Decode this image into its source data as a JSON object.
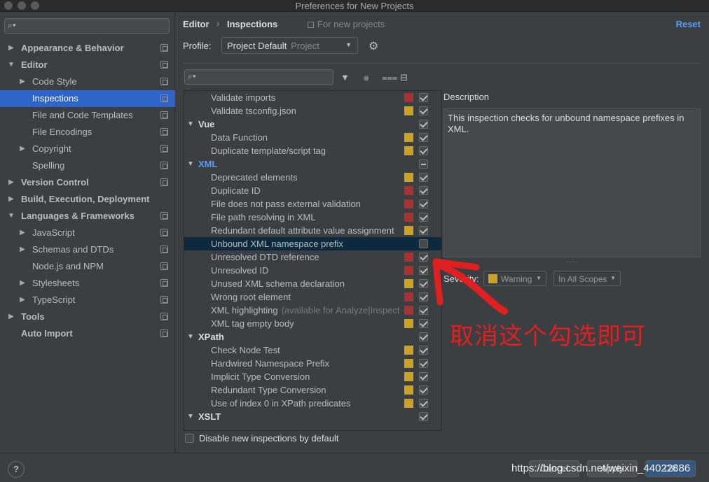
{
  "window": {
    "title": "Preferences for New Projects"
  },
  "sidebar": {
    "search_placeholder": "",
    "items": [
      {
        "label": "Appearance & Behavior",
        "bold": true,
        "level": 0,
        "arrow": "▶",
        "copy": true
      },
      {
        "label": "Editor",
        "bold": true,
        "level": 0,
        "arrow": "▼",
        "copy": true
      },
      {
        "label": "Code Style",
        "bold": false,
        "level": 1,
        "arrow": "▶",
        "copy": true
      },
      {
        "label": "Inspections",
        "bold": false,
        "level": 1,
        "arrow": "",
        "copy": true,
        "selected": true
      },
      {
        "label": "File and Code Templates",
        "bold": false,
        "level": 1,
        "arrow": "",
        "copy": true
      },
      {
        "label": "File Encodings",
        "bold": false,
        "level": 1,
        "arrow": "",
        "copy": true
      },
      {
        "label": "Copyright",
        "bold": false,
        "level": 1,
        "arrow": "▶",
        "copy": true
      },
      {
        "label": "Spelling",
        "bold": false,
        "level": 1,
        "arrow": "",
        "copy": true
      },
      {
        "label": "Version Control",
        "bold": true,
        "level": 0,
        "arrow": "▶",
        "copy": true
      },
      {
        "label": "Build, Execution, Deployment",
        "bold": true,
        "level": 0,
        "arrow": "▶",
        "copy": false
      },
      {
        "label": "Languages & Frameworks",
        "bold": true,
        "level": 0,
        "arrow": "▼",
        "copy": true
      },
      {
        "label": "JavaScript",
        "bold": false,
        "level": 1,
        "arrow": "▶",
        "copy": true
      },
      {
        "label": "Schemas and DTDs",
        "bold": false,
        "level": 1,
        "arrow": "▶",
        "copy": true
      },
      {
        "label": "Node.js and NPM",
        "bold": false,
        "level": 1,
        "arrow": "",
        "copy": true
      },
      {
        "label": "Stylesheets",
        "bold": false,
        "level": 1,
        "arrow": "▶",
        "copy": true
      },
      {
        "label": "TypeScript",
        "bold": false,
        "level": 1,
        "arrow": "▶",
        "copy": true
      },
      {
        "label": "Tools",
        "bold": true,
        "level": 0,
        "arrow": "▶",
        "copy": true
      },
      {
        "label": "Auto Import",
        "bold": true,
        "level": 0,
        "arrow": "",
        "copy": true
      }
    ]
  },
  "header": {
    "breadcrumb_1": "Editor",
    "breadcrumb_sep": "›",
    "breadcrumb_2": "Inspections",
    "for_new_projects": "For new projects",
    "reset_label": "Reset"
  },
  "profile": {
    "label": "Profile:",
    "value": "Project Default",
    "value_sub": "Project"
  },
  "inspections": {
    "search_placeholder": "",
    "rows": [
      {
        "type": "item",
        "label": "Validate imports",
        "severity": "#a83232",
        "check": "checked"
      },
      {
        "type": "item",
        "label": "Validate tsconfig.json",
        "severity": "#c9a227",
        "check": "checked"
      },
      {
        "type": "group",
        "label": "Vue",
        "arrow": "▼",
        "check": "checked"
      },
      {
        "type": "item",
        "label": "Data Function",
        "severity": "#c9a227",
        "check": "checked"
      },
      {
        "type": "item",
        "label": "Duplicate template/script tag",
        "severity": "#c9a227",
        "check": "checked"
      },
      {
        "type": "group",
        "label": "XML",
        "arrow": "▼",
        "check": "partial",
        "blue": true
      },
      {
        "type": "item",
        "label": "Deprecated elements",
        "severity": "#c9a227",
        "check": "checked"
      },
      {
        "type": "item",
        "label": "Duplicate ID",
        "severity": "#a83232",
        "check": "checked"
      },
      {
        "type": "item",
        "label": "File does not pass external validation",
        "severity": "#a83232",
        "check": "checked"
      },
      {
        "type": "item",
        "label": "File path resolving in XML",
        "severity": "#a83232",
        "check": "checked"
      },
      {
        "type": "item",
        "label": "Redundant default attribute value assignment",
        "severity": "#c9a227",
        "check": "checked"
      },
      {
        "type": "item",
        "label": "Unbound XML namespace prefix",
        "severity": "",
        "check": "unchecked",
        "selected": true
      },
      {
        "type": "item",
        "label": "Unresolved DTD reference",
        "severity": "#a83232",
        "check": "checked"
      },
      {
        "type": "item",
        "label": "Unresolved ID",
        "severity": "#a83232",
        "check": "checked"
      },
      {
        "type": "item",
        "label": "Unused XML schema declaration",
        "severity": "#c9a227",
        "check": "checked"
      },
      {
        "type": "item",
        "label": "Wrong root element",
        "severity": "#a83232",
        "check": "checked"
      },
      {
        "type": "item",
        "label": "XML highlighting",
        "dim": "(available for Analyze|Inspect Code)",
        "severity": "#a83232",
        "check": "checked"
      },
      {
        "type": "item",
        "label": "XML tag empty body",
        "severity": "#c9a227",
        "check": "checked"
      },
      {
        "type": "group",
        "label": "XPath",
        "arrow": "▼",
        "check": "checked"
      },
      {
        "type": "item",
        "label": "Check Node Test",
        "severity": "#c9a227",
        "check": "checked"
      },
      {
        "type": "item",
        "label": "Hardwired Namespace Prefix",
        "severity": "#c9a227",
        "check": "checked"
      },
      {
        "type": "item",
        "label": "Implicit Type Conversion",
        "severity": "#c9a227",
        "check": "checked"
      },
      {
        "type": "item",
        "label": "Redundant Type Conversion",
        "severity": "#c9a227",
        "check": "checked"
      },
      {
        "type": "item",
        "label": "Use of index 0 in XPath predicates",
        "severity": "#c9a227",
        "check": "checked"
      },
      {
        "type": "group",
        "label": "XSLT",
        "arrow": "▼",
        "check": "checked"
      }
    ]
  },
  "description": {
    "label": "Description",
    "text": "This inspection checks for unbound namespace prefixes in XML."
  },
  "severity": {
    "label": "Severity:",
    "value": "Warning",
    "color": "#c9a227",
    "scope": "In All Scopes"
  },
  "disable_new": {
    "label": "Disable new inspections by default"
  },
  "footer": {
    "help": "?",
    "cancel_label": "Cancel",
    "apply_label": "Apply",
    "ok_label": "OK",
    "watermark": "https://blog.csdn.net/weixin_44022886"
  },
  "annotation": {
    "text": "取消这个勾选即可",
    "color": "#e02020"
  }
}
